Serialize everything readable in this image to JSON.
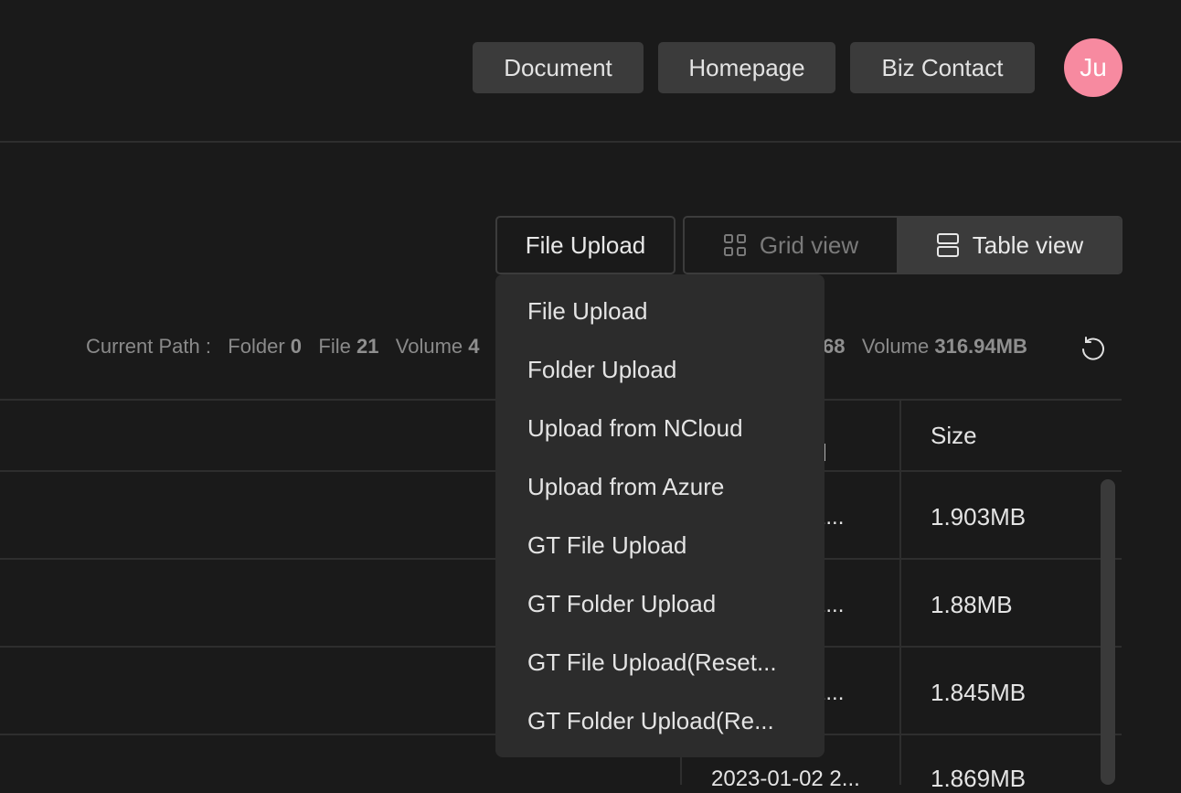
{
  "header": {
    "nav_buttons": [
      "Document",
      "Homepage",
      "Biz Contact"
    ],
    "avatar_initials": "Ju",
    "avatar_color": "#f78aa0"
  },
  "toolbar": {
    "upload_label": "File Upload",
    "grid_view_label": "Grid view",
    "table_view_label": "Table view",
    "active_view": "Table view"
  },
  "stats": {
    "current_path_label": "Current Path :",
    "folder_label": "Folder",
    "folder_count": "0",
    "file_label": "File",
    "file_count": "21",
    "volume_label": "Volume",
    "volume_partial": "4",
    "total_partial_count": "68",
    "total_volume_label": "Volume",
    "total_volume": "316.94MB"
  },
  "table": {
    "headers": {
      "date_partial": "d",
      "size": "Size"
    },
    "rows": [
      {
        "date": "2023-01-02 2...",
        "date_visible": "2 2...",
        "size": "1.903MB"
      },
      {
        "date": "2023-01-02 2...",
        "date_visible": "2 2...",
        "size": "1.88MB"
      },
      {
        "date": "2023-01-02 2...",
        "date_visible": "2 2...",
        "size": "1.845MB"
      },
      {
        "date": "2023-01-02 2...",
        "date_visible": "2023-01-02 2...",
        "size": "1.869MB"
      }
    ]
  },
  "upload_menu": {
    "items": [
      "File Upload",
      "Folder Upload",
      "Upload from NCloud",
      "Upload from Azure",
      "GT File Upload",
      "GT Folder Upload",
      "GT File Upload(Reset...",
      "GT Folder Upload(Re..."
    ]
  }
}
